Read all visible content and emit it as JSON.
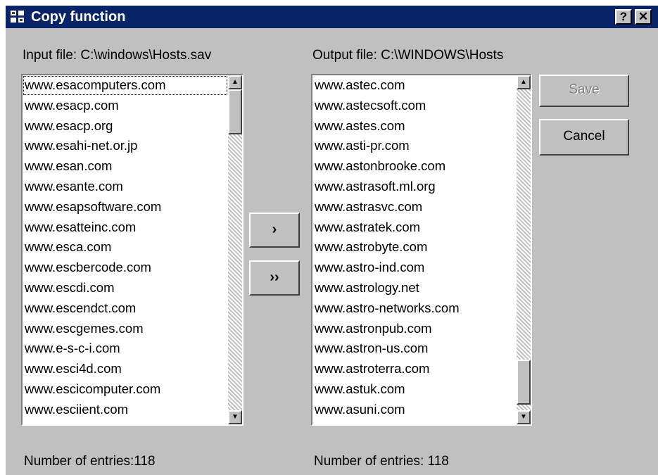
{
  "window": {
    "title": "Copy function",
    "help_label": "?",
    "close_label": "✕"
  },
  "input": {
    "label": "Input file: C:\\windows\\Hosts.sav",
    "items": [
      "www.esacomputers.com",
      "www.esacp.com",
      "www.esacp.org",
      "www.esahi-net.or.jp",
      "www.esan.com",
      "www.esante.com",
      "www.esapsoftware.com",
      "www.esatteinc.com",
      "www.esca.com",
      "www.escbercode.com",
      "www.escdi.com",
      "www.escendct.com",
      "www.escgemes.com",
      "www.e-s-c-i.com",
      "www.esci4d.com",
      "www.escicomputer.com",
      "www.esciient.com"
    ],
    "count_label": "Number of entries:118"
  },
  "output": {
    "label": "Output file: C:\\WINDOWS\\Hosts",
    "items": [
      "www.astec.com",
      "www.astecsoft.com",
      "www.astes.com",
      "www.asti-pr.com",
      "www.astonbrooke.com",
      "www.astrasoft.ml.org",
      "www.astrasvc.com",
      "www.astratek.com",
      "www.astrobyte.com",
      "www.astro-ind.com",
      "www.astrology.net",
      "www.astro-networks.com",
      "www.astronpub.com",
      "www.astron-us.com",
      "www.astroterra.com",
      "www.astuk.com",
      "www.asuni.com"
    ],
    "count_label": "Number of entries: 118"
  },
  "buttons": {
    "copy_one": "›",
    "copy_all": "››",
    "save": "Save",
    "cancel": "Cancel"
  },
  "colors": {
    "titlebar": "#0a246a",
    "face": "#c0c0c0"
  }
}
